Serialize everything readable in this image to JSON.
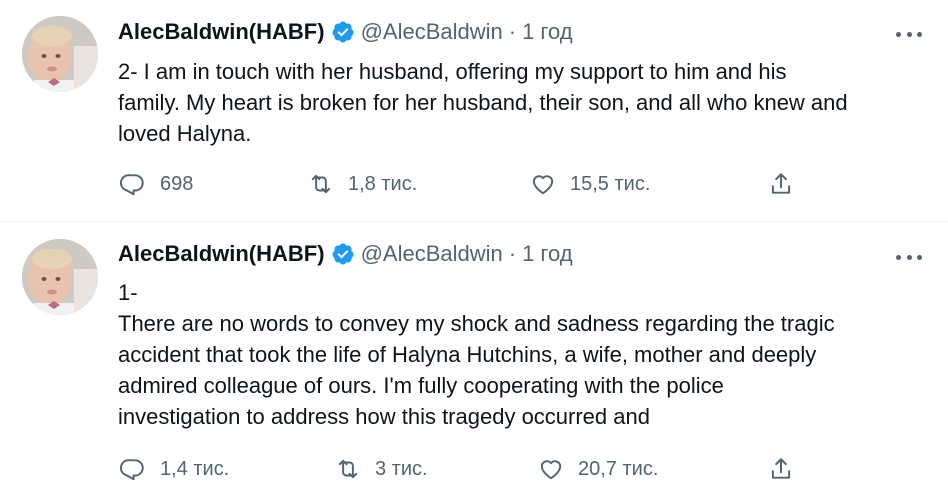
{
  "tweets": [
    {
      "author_name": "AlecBaldwin(HABF)",
      "handle": "@AlecBaldwin",
      "separator": "·",
      "time": "1 год",
      "text_lines": [
        "2- I am in touch with her husband, offering my support to him and his",
        "family. My heart is broken for her husband, their son, and all who knew and",
        "loved Halyna."
      ],
      "replies": "698",
      "retweets": "1,8 тис.",
      "likes": "15,5 тис."
    },
    {
      "author_name": "AlecBaldwin(HABF)",
      "handle": "@AlecBaldwin",
      "separator": "·",
      "time": "1 год",
      "text_lines": [
        "1-",
        "There are no words to convey my shock and sadness regarding the tragic",
        "accident that took the life of Halyna Hutchins, a wife, mother and deeply",
        "admired colleague of ours. I'm fully cooperating with the police",
        "investigation to address how this tragedy occurred and"
      ],
      "replies": "1,4 тис.",
      "retweets": "3 тис.",
      "likes": "20,7 тис."
    }
  ],
  "icons": {
    "verified": "verified-badge-icon",
    "more": "more-icon",
    "reply": "reply-icon",
    "retweet": "retweet-icon",
    "like": "like-icon",
    "share": "share-icon"
  },
  "colors": {
    "verified": "#1d9bf0",
    "secondary_text": "#536471",
    "primary_text": "#0f1419",
    "divider": "#eff3f4"
  }
}
